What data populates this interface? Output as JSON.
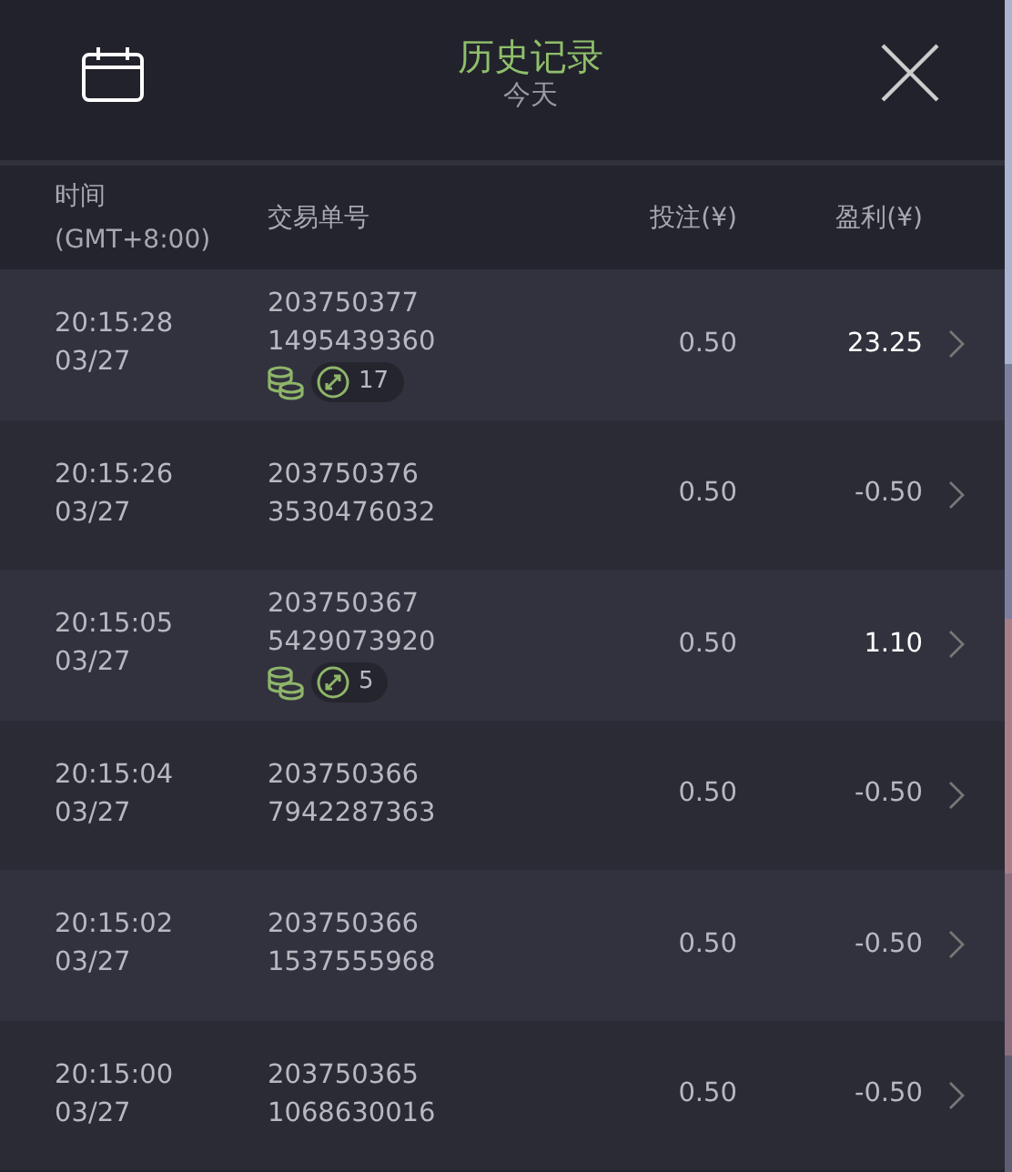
{
  "header": {
    "title": "历史记录",
    "subtitle": "今天"
  },
  "columns": [
    {
      "label": "时间",
      "sublabel": "(GMT+8:00)"
    },
    {
      "label": "交易单号"
    },
    {
      "label": "投注(¥)"
    },
    {
      "label": "盈利(¥)"
    }
  ],
  "rows": [
    {
      "time": "20:15:28",
      "date": "03/27",
      "order_1": "203750377",
      "order_2": "1495439360",
      "bonus_count": "17",
      "stake": "0.50",
      "profit": "23.25",
      "won": true
    },
    {
      "time": "20:15:26",
      "date": "03/27",
      "order_1": "203750376",
      "order_2": "3530476032",
      "stake": "0.50",
      "profit": "-0.50",
      "won": false
    },
    {
      "time": "20:15:05",
      "date": "03/27",
      "order_1": "203750367",
      "order_2": "5429073920",
      "bonus_count": "5",
      "stake": "0.50",
      "profit": "1.10",
      "won": true
    },
    {
      "time": "20:15:04",
      "date": "03/27",
      "order_1": "203750366",
      "order_2": "7942287363",
      "stake": "0.50",
      "profit": "-0.50",
      "won": false
    },
    {
      "time": "20:15:02",
      "date": "03/27",
      "order_1": "203750366",
      "order_2": "1537555968",
      "stake": "0.50",
      "profit": "-0.50",
      "won": false
    },
    {
      "time": "20:15:00",
      "date": "03/27",
      "order_1": "203750365",
      "order_2": "1068630016",
      "stake": "0.50",
      "profit": "-0.50",
      "won": false
    }
  ]
}
